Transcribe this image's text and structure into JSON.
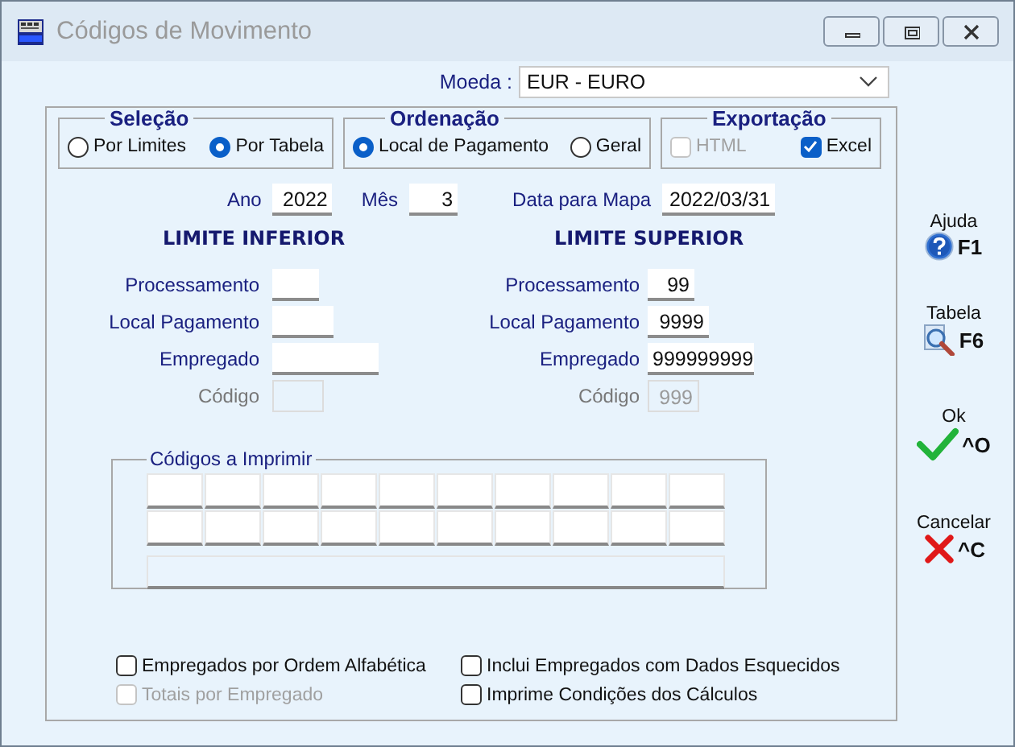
{
  "window": {
    "title": "Códigos de Movimento"
  },
  "currency": {
    "label": "Moeda :",
    "value": "EUR - EURO"
  },
  "groups": [
    {
      "title": "Seleção",
      "options": [
        {
          "kind": "radio",
          "label": "Por Limites",
          "selected": false,
          "disabled": false
        },
        {
          "kind": "radio",
          "label": "Por Tabela",
          "selected": true,
          "disabled": false
        }
      ]
    },
    {
      "title": "Ordenação",
      "options": [
        {
          "kind": "radio",
          "label": "Local de Pagamento",
          "selected": true,
          "disabled": false
        },
        {
          "kind": "radio",
          "label": "Geral",
          "selected": false,
          "disabled": false
        }
      ]
    },
    {
      "title": "Exportação",
      "options": [
        {
          "kind": "checkbox",
          "label": "HTML",
          "checked": false,
          "disabled": true
        },
        {
          "kind": "checkbox",
          "label": "Excel",
          "checked": true,
          "disabled": false
        }
      ]
    }
  ],
  "period": [
    {
      "label": "Ano",
      "value": "2022"
    },
    {
      "label": "Mês",
      "value": "3"
    },
    {
      "label": "Data para Mapa",
      "value": "2022/03/31"
    }
  ],
  "limits": [
    {
      "heading": "LIMITE INFERIOR",
      "fields": [
        {
          "label": "Processamento",
          "disabled": false
        },
        {
          "label": "Local Pagamento",
          "disabled": false
        },
        {
          "label": "Empregado",
          "disabled": false
        },
        {
          "label": "Código",
          "disabled": true
        }
      ]
    },
    {
      "heading": "LIMITE SUPERIOR",
      "fields": [
        {
          "label": "Processamento",
          "value": "99",
          "disabled": false
        },
        {
          "label": "Local Pagamento",
          "value": "9999",
          "disabled": false
        },
        {
          "label": "Empregado",
          "value": "999999999",
          "disabled": false
        },
        {
          "label": "Código",
          "value": "999",
          "disabled": true
        }
      ]
    }
  ],
  "print_codes": {
    "title": "Códigos a Imprimir"
  },
  "options": [
    {
      "label": "Empregados por Ordem Alfabética",
      "checked": false,
      "disabled": false
    },
    {
      "label": "Inclui Empregados com Dados Esquecidos",
      "checked": false,
      "disabled": false
    },
    {
      "label": "Totais por Empregado",
      "checked": false,
      "disabled": true
    },
    {
      "label": "Imprime Condições dos Cálculos",
      "checked": false,
      "disabled": false
    }
  ],
  "actions": [
    {
      "kind": "help",
      "label": "Ajuda",
      "key": "F1"
    },
    {
      "kind": "search",
      "label": "Tabela",
      "key": "F6"
    },
    {
      "kind": "check",
      "label": "Ok",
      "key": "^O"
    },
    {
      "kind": "cross",
      "label": "Cancelar",
      "key": "^C"
    }
  ]
}
